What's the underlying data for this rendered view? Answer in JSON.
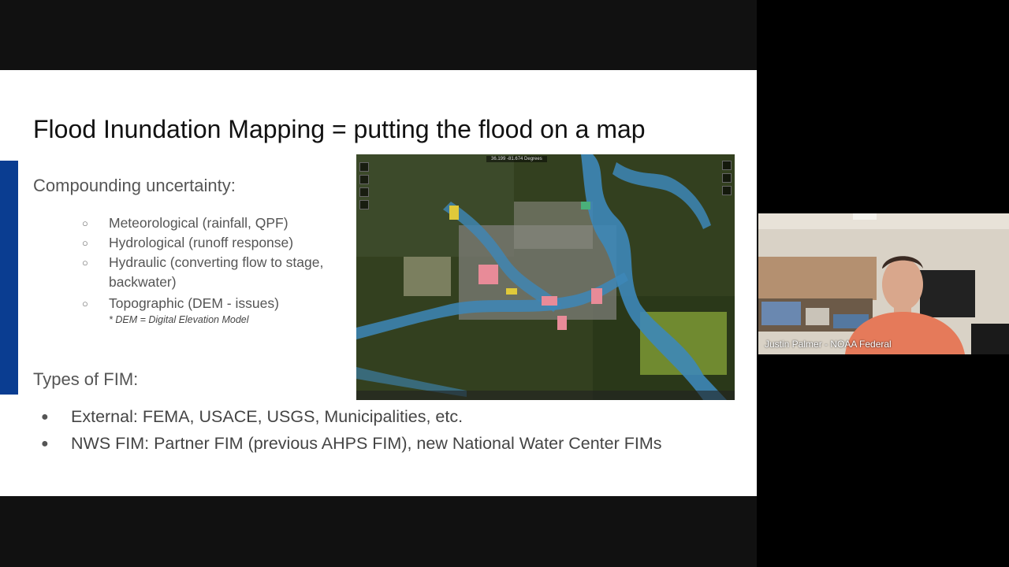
{
  "slide": {
    "title": "Flood Inundation Mapping = putting the flood on a map",
    "subhead1": "Compounding uncertainty:",
    "uncertainty_bullets": [
      "Meteorological (rainfall, QPF)",
      "Hydrological (runoff response)",
      "Hydraulic (converting flow to stage,",
      "backwater)",
      "Topographic (DEM - issues)"
    ],
    "bullet_marker": "○",
    "footnote": "* DEM = Digital Elevation Model",
    "subhead2": "Types of FIM:",
    "fim_bullets": [
      "External: FEMA, USACE, USGS, Municipalities, etc.",
      "NWS FIM: Partner FIM (previous AHPS FIM), new National Water Center FIMs"
    ],
    "big_bullet_marker": "●",
    "accent_color": "#0a3d91"
  },
  "map": {
    "coords_text": "36.199 -81.674 Degrees"
  },
  "video": {
    "participant_name": "Justin Palmer - NOAA Federal"
  }
}
